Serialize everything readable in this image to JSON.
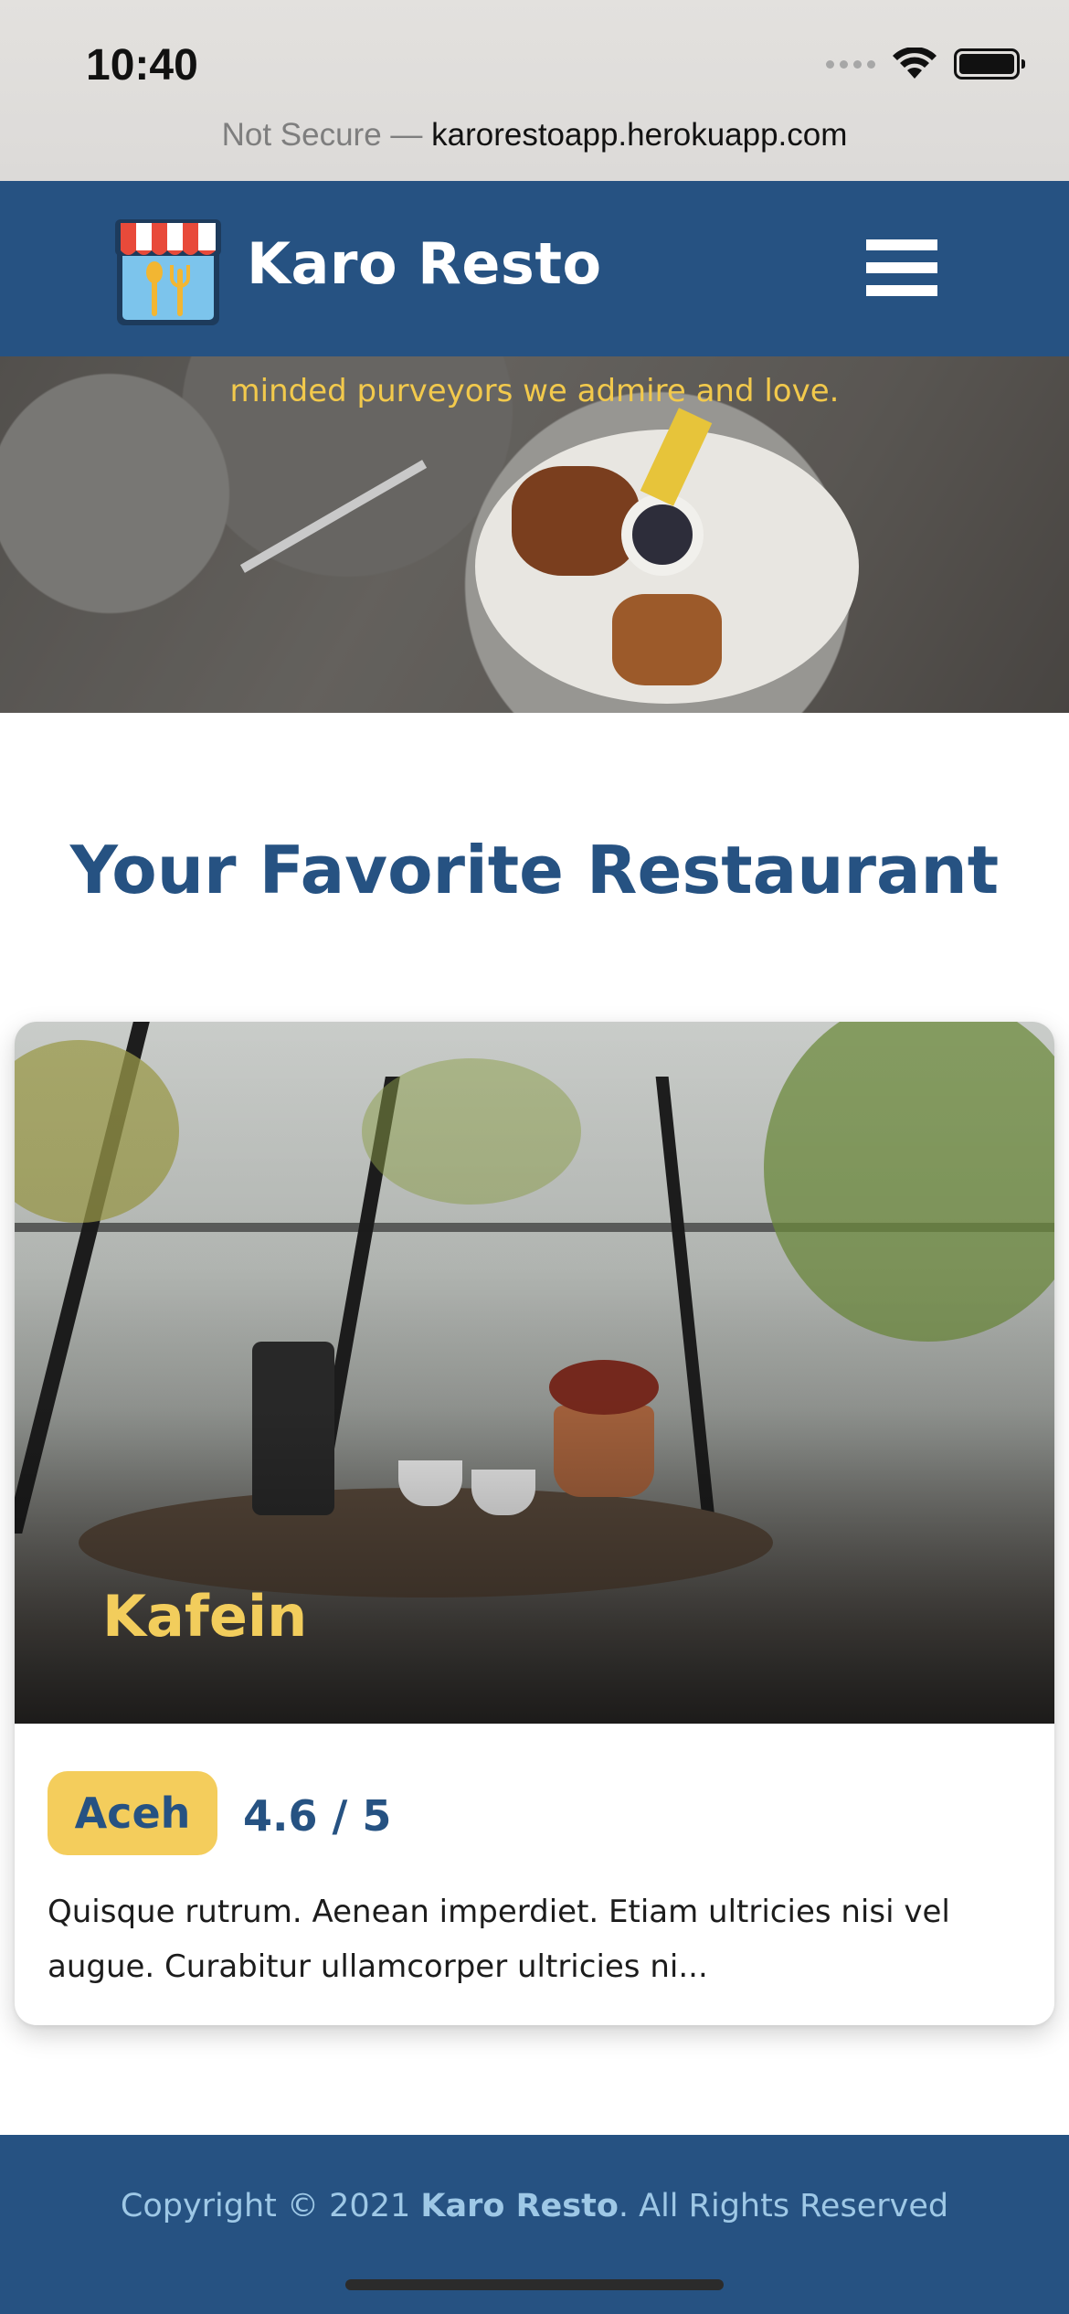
{
  "status_bar": {
    "time": "10:40",
    "icons": [
      "signal-icon",
      "wifi-icon",
      "battery-icon"
    ]
  },
  "browser": {
    "security_label": "Not Secure —",
    "url": "karorestoapp.herokuapp.com"
  },
  "header": {
    "brand_name": "Karo Resto",
    "logo_icon": "store-icon",
    "menu_icon": "hamburger-icon"
  },
  "hero": {
    "tagline_partial": "minded purveyors we admire and love."
  },
  "main": {
    "section_title": "Your Favorite Restaurant",
    "restaurants": [
      {
        "name": "Kafein",
        "city": "Aceh",
        "rating": "4.6 / 5",
        "description": "Quisque rutrum. Aenean imperdiet. Etiam ultricies nisi vel augue. Curabitur ullamcorper ultricies ni..."
      }
    ]
  },
  "footer": {
    "prefix": "Copyright © 2021 ",
    "brand": "Karo Resto",
    "suffix": ". All Rights Reserved"
  },
  "colors": {
    "primary": "#265282",
    "accent": "#f2cd5c",
    "footer_text": "#9ec8e6"
  }
}
